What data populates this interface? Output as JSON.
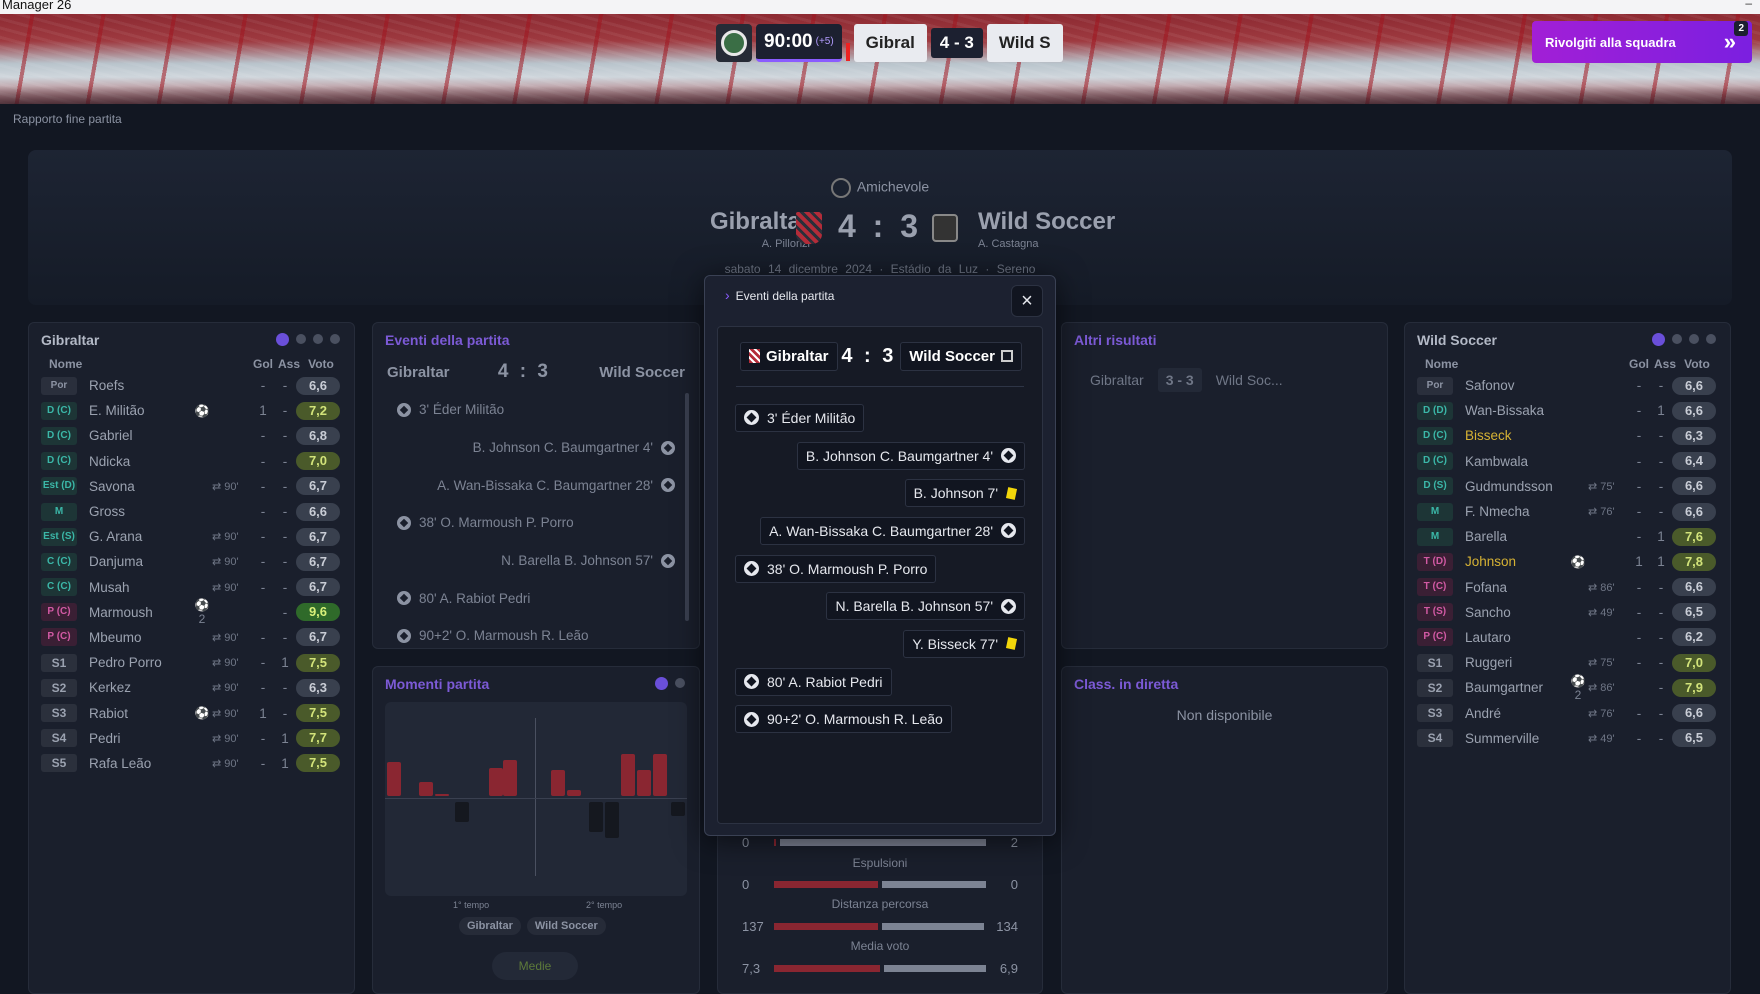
{
  "app": {
    "title": "Manager 26",
    "minimize": "–"
  },
  "scorebar": {
    "time": "90:00",
    "added": "(+5)",
    "home": "Gibral",
    "score": "4 - 3",
    "away": "Wild S"
  },
  "cta": {
    "label": "Rivolgiti alla squadra",
    "arrow": "»",
    "count": "2"
  },
  "page": {
    "report_label": "Rapporto fine partita"
  },
  "match": {
    "competition": "Amichevole",
    "home": "Gibraltar",
    "home_coach": "A. Pillonzi",
    "away": "Wild Soccer",
    "away_coach": "A. Castagna",
    "score": "4 : 3",
    "meta": "sabato 14 dicembre 2024   ·   Estádio da Luz   ·   Sereno"
  },
  "home_panel": {
    "title": "Gibraltar",
    "cols": {
      "name": "Nome",
      "goals": "Gol",
      "assists": "Ass",
      "rating": "Voto"
    },
    "players": [
      {
        "pos": "Por",
        "pc": "gk",
        "name": "Roefs",
        "sub": "",
        "ev": "",
        "g": "-",
        "a": "-",
        "v": "6,6",
        "vc": ""
      },
      {
        "pos": "D (C)",
        "pc": "d",
        "name": "E. Militão",
        "sub": "",
        "ev": "⚽",
        "g": "1",
        "a": "-",
        "v": "7,2",
        "vc": "good"
      },
      {
        "pos": "D (C)",
        "pc": "d",
        "name": "Gabriel",
        "sub": "",
        "ev": "",
        "g": "-",
        "a": "-",
        "v": "6,8",
        "vc": ""
      },
      {
        "pos": "D (C)",
        "pc": "d",
        "name": "Ndicka",
        "sub": "",
        "ev": "",
        "g": "-",
        "a": "-",
        "v": "7,0",
        "vc": "good"
      },
      {
        "pos": "Est (D)",
        "pc": "d",
        "name": "Savona",
        "sub": "⇄ 90'",
        "ev": "",
        "g": "-",
        "a": "-",
        "v": "6,7",
        "vc": ""
      },
      {
        "pos": "M",
        "pc": "m",
        "name": "Gross",
        "sub": "",
        "ev": "",
        "g": "-",
        "a": "-",
        "v": "6,6",
        "vc": ""
      },
      {
        "pos": "Est (S)",
        "pc": "d",
        "name": "G. Arana",
        "sub": "⇄ 90'",
        "ev": "",
        "g": "-",
        "a": "-",
        "v": "6,7",
        "vc": ""
      },
      {
        "pos": "C (C)",
        "pc": "d",
        "name": "Danjuma",
        "sub": "⇄ 90'",
        "ev": "",
        "g": "-",
        "a": "-",
        "v": "6,7",
        "vc": ""
      },
      {
        "pos": "C (C)",
        "pc": "d",
        "name": "Musah",
        "sub": "⇄ 90'",
        "ev": "",
        "g": "-",
        "a": "-",
        "v": "6,7",
        "vc": ""
      },
      {
        "pos": "P (C)",
        "pc": "p",
        "name": "Marmoush",
        "sub": "",
        "ev": "⚽2",
        "g": "",
        "a": "-",
        "v": "9,6",
        "vc": "great"
      },
      {
        "pos": "P (C)",
        "pc": "p",
        "name": "Mbeumo",
        "sub": "⇄ 90'",
        "ev": "",
        "g": "-",
        "a": "-",
        "v": "6,7",
        "vc": ""
      },
      {
        "pos": "S1",
        "pc": "s",
        "name": "Pedro Porro",
        "sub": "⇄ 90'",
        "ev": "",
        "g": "-",
        "a": "1",
        "v": "7,5",
        "vc": "good"
      },
      {
        "pos": "S2",
        "pc": "s",
        "name": "Kerkez",
        "sub": "⇄ 90'",
        "ev": "",
        "g": "-",
        "a": "-",
        "v": "6,3",
        "vc": ""
      },
      {
        "pos": "S3",
        "pc": "s",
        "name": "Rabiot",
        "sub": "⇄ 90'",
        "ev": "⚽",
        "g": "1",
        "a": "-",
        "v": "7,5",
        "vc": "good"
      },
      {
        "pos": "S4",
        "pc": "s",
        "name": "Pedri",
        "sub": "⇄ 90'",
        "ev": "",
        "g": "-",
        "a": "1",
        "v": "7,7",
        "vc": "good"
      },
      {
        "pos": "S5",
        "pc": "s",
        "name": "Rafa Leão",
        "sub": "⇄ 90'",
        "ev": "",
        "g": "-",
        "a": "1",
        "v": "7,5",
        "vc": "good"
      }
    ]
  },
  "away_panel": {
    "title": "Wild Soccer",
    "cols": {
      "name": "Nome",
      "goals": "Gol",
      "assists": "Ass",
      "rating": "Voto"
    },
    "players": [
      {
        "pos": "Por",
        "pc": "gk",
        "name": "Safonov",
        "sub": "",
        "ev": "",
        "g": "-",
        "a": "-",
        "v": "6,6",
        "vc": "",
        "yl": false
      },
      {
        "pos": "D (D)",
        "pc": "d",
        "name": "Wan-Bissaka",
        "sub": "",
        "ev": "",
        "g": "-",
        "a": "1",
        "v": "6,6",
        "vc": "",
        "yl": false
      },
      {
        "pos": "D (C)",
        "pc": "d",
        "name": "Bisseck",
        "sub": "",
        "ev": "",
        "g": "-",
        "a": "-",
        "v": "6,3",
        "vc": "",
        "yl": true
      },
      {
        "pos": "D (C)",
        "pc": "d",
        "name": "Kambwala",
        "sub": "",
        "ev": "",
        "g": "-",
        "a": "-",
        "v": "6,4",
        "vc": "",
        "yl": false
      },
      {
        "pos": "D (S)",
        "pc": "d",
        "name": "Gudmundsson",
        "sub": "⇄ 75'",
        "ev": "",
        "g": "-",
        "a": "-",
        "v": "6,6",
        "vc": "",
        "yl": false
      },
      {
        "pos": "M",
        "pc": "m",
        "name": "F. Nmecha",
        "sub": "⇄ 76'",
        "ev": "",
        "g": "-",
        "a": "-",
        "v": "6,6",
        "vc": "",
        "yl": false
      },
      {
        "pos": "M",
        "pc": "m",
        "name": "Barella",
        "sub": "",
        "ev": "",
        "g": "-",
        "a": "1",
        "v": "7,6",
        "vc": "good",
        "yl": false
      },
      {
        "pos": "T (D)",
        "pc": "t",
        "name": "Johnson",
        "sub": "",
        "ev": "⚽",
        "g": "1",
        "a": "1",
        "v": "7,8",
        "vc": "good",
        "yl": true
      },
      {
        "pos": "T (C)",
        "pc": "t",
        "name": "Fofana",
        "sub": "⇄ 86'",
        "ev": "",
        "g": "-",
        "a": "-",
        "v": "6,6",
        "vc": "",
        "yl": false
      },
      {
        "pos": "T (S)",
        "pc": "t",
        "name": "Sancho",
        "sub": "⇄ 49'",
        "ev": "",
        "g": "-",
        "a": "-",
        "v": "6,5",
        "vc": "",
        "yl": false
      },
      {
        "pos": "P (C)",
        "pc": "p",
        "name": "Lautaro",
        "sub": "",
        "ev": "",
        "g": "-",
        "a": "-",
        "v": "6,2",
        "vc": "",
        "yl": false
      },
      {
        "pos": "S1",
        "pc": "s",
        "name": "Ruggeri",
        "sub": "⇄ 75'",
        "ev": "",
        "g": "-",
        "a": "-",
        "v": "7,0",
        "vc": "good",
        "yl": false
      },
      {
        "pos": "S2",
        "pc": "s",
        "name": "Baumgartner",
        "sub": "⇄ 86'",
        "ev": "⚽2",
        "g": "",
        "a": "-",
        "v": "7,9",
        "vc": "good",
        "yl": false
      },
      {
        "pos": "S3",
        "pc": "s",
        "name": "André",
        "sub": "⇄ 76'",
        "ev": "",
        "g": "-",
        "a": "-",
        "v": "6,6",
        "vc": "",
        "yl": false
      },
      {
        "pos": "S4",
        "pc": "s",
        "name": "Summerville",
        "sub": "⇄ 49'",
        "ev": "",
        "g": "-",
        "a": "-",
        "v": "6,5",
        "vc": "",
        "yl": false
      }
    ]
  },
  "events_panel": {
    "title": "Eventi della partita",
    "home": "Gibraltar",
    "score": "4 : 3",
    "away": "Wild Soccer",
    "items": [
      {
        "side": "l",
        "text": "3' Éder Militão"
      },
      {
        "side": "r",
        "text": "B. Johnson C. Baumgartner 4'"
      },
      {
        "side": "r",
        "text": "A. Wan-Bissaka C. Baumgartner 28'"
      },
      {
        "side": "l",
        "text": "38' O. Marmoush P. Porro"
      },
      {
        "side": "r",
        "text": "N. Barella B. Johnson 57'"
      },
      {
        "side": "l",
        "text": "80' A. Rabiot Pedri"
      },
      {
        "side": "l",
        "text": "90+2' O. Marmoush R. Leão"
      }
    ]
  },
  "altri": {
    "title": "Altri risultati",
    "home": "Gibraltar",
    "score": "3 - 3",
    "away": "Wild Soc..."
  },
  "classifica": {
    "title": "Class. in diretta",
    "text": "Non disponibile"
  },
  "momenti": {
    "title": "Momenti partita",
    "first_half": "1° tempo",
    "second_half": "2° tempo",
    "legend_home": "Gibraltar",
    "legend_away": "Wild Soccer",
    "button": "Medie"
  },
  "stats": {
    "rows": [
      {
        "label": "",
        "l": "0",
        "r": "2",
        "lw": 0,
        "rw": 1
      },
      {
        "label": "Espulsioni",
        "l": "0",
        "r": "0",
        "lw": 0.5,
        "rw": 0.5
      },
      {
        "label": "Distanza percorsa",
        "l": "137",
        "r": "134",
        "lw": 0.5,
        "rw": 0.49
      },
      {
        "label": "Media voto",
        "l": "7,3",
        "r": "6,9",
        "lw": 0.51,
        "rw": 0.49
      }
    ]
  },
  "modal": {
    "title": "Eventi della partita",
    "close": "×",
    "home": "Gibraltar",
    "score": "4 : 3",
    "away": "Wild Soccer",
    "items": [
      {
        "side": "l",
        "kind": "goal",
        "text": "3' Éder Militão"
      },
      {
        "side": "r",
        "kind": "goal",
        "text": "B. Johnson C. Baumgartner 4'"
      },
      {
        "side": "r",
        "kind": "yellow",
        "text": "B. Johnson 7'"
      },
      {
        "side": "r",
        "kind": "goal",
        "text": "A. Wan-Bissaka C. Baumgartner 28'"
      },
      {
        "side": "l",
        "kind": "goal",
        "text": "38' O. Marmoush P. Porro"
      },
      {
        "side": "r",
        "kind": "goal",
        "text": "N. Barella B. Johnson 57'"
      },
      {
        "side": "r",
        "kind": "yellow",
        "text": "Y. Bisseck 77'"
      },
      {
        "side": "l",
        "kind": "goal",
        "text": "80' A. Rabiot Pedri"
      },
      {
        "side": "l",
        "kind": "goal",
        "text": "90+2' O. Marmoush R. Leão"
      }
    ]
  },
  "colors": {
    "accent": "#8a5cff",
    "home": "#8a2631",
    "cta": "#a21fd6",
    "yellow_card": "#f2d60a"
  }
}
